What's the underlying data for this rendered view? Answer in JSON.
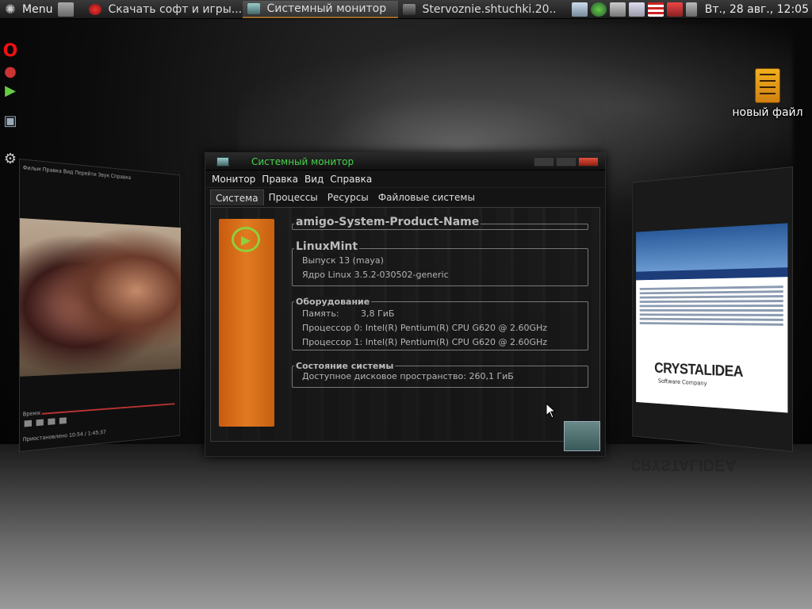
{
  "top_panel": {
    "menu_label": "Menu",
    "tasks": [
      {
        "label": "Скачать софт и игры...",
        "active": false
      },
      {
        "label": "Системный монитор",
        "active": true
      },
      {
        "label": "Stervoznie.shtuchki.20...",
        "active": false
      }
    ],
    "clock": "Вт., 28 авг., 12:05"
  },
  "desktop": {
    "icon_label": "новый файл"
  },
  "left_window": {
    "menu": "Фильм  Правка  Вид  Перейти  Звук  Справка",
    "time_label": "Время:",
    "status": "Приостановлено   10:54 / 1:45:37"
  },
  "right_window": {
    "logo_text": "CRYSTALIDEA",
    "logo_sub": "Software Company"
  },
  "sysmon": {
    "title": "Системный монитор",
    "menu": [
      {
        "label": "Монитор"
      },
      {
        "label": "Правка"
      },
      {
        "label": "Вид"
      },
      {
        "label": "Справка"
      }
    ],
    "tabs": [
      {
        "label": "Система",
        "active": true
      },
      {
        "label": "Процессы",
        "active": false
      },
      {
        "label": "Ресурсы",
        "active": false
      },
      {
        "label": "Файловые системы",
        "active": false
      }
    ],
    "hostname": "amigo-System-Product-Name",
    "os": {
      "title": "LinuxMint",
      "release": "Выпуск 13 (maya)",
      "kernel": "Ядро Linux 3.5.2-030502-generic"
    },
    "hardware": {
      "title": "Оборудование",
      "memory_label": "Память:",
      "memory_value": "3,8 ГиБ",
      "cpu0": "Процессор 0: Intel(R) Pentium(R) CPU G620 @ 2.60GHz",
      "cpu1": "Процессор 1: Intel(R) Pentium(R) CPU G620 @ 2.60GHz"
    },
    "status": {
      "title": "Состояние системы",
      "disk": "Доступное дисковое пространство: 260,1 ГиБ"
    }
  },
  "colors": {
    "title_green": "#44d44a",
    "accent_orange": "#e07a20"
  }
}
